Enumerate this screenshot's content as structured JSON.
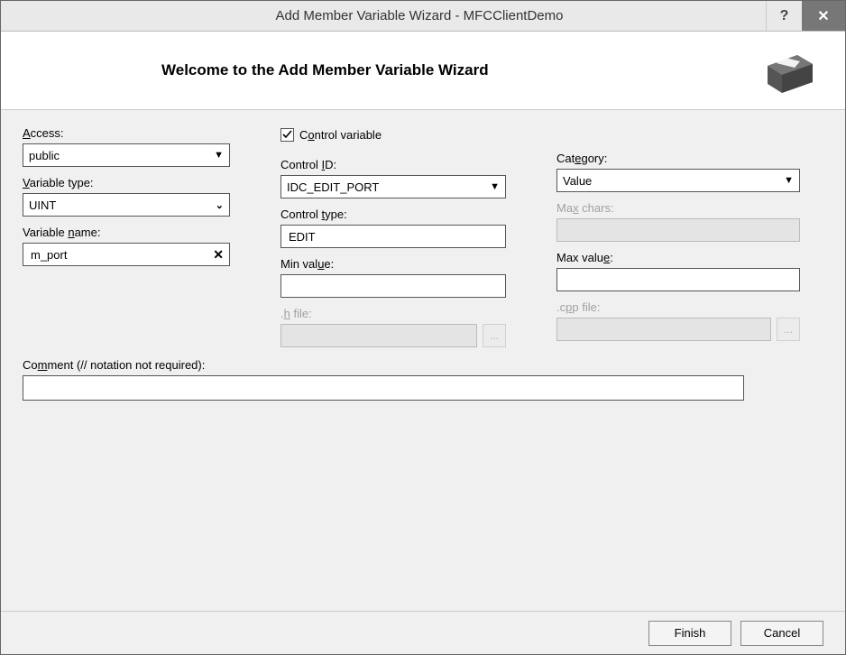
{
  "title": "Add Member Variable Wizard - MFCClientDemo",
  "help_symbol": "?",
  "close_symbol": "✕",
  "banner_heading": "Welcome to the Add Member Variable Wizard",
  "form": {
    "access_label": "Access:",
    "access_value": "public",
    "variable_type_label": "Variable type:",
    "variable_type_value": "UINT",
    "variable_name_label": "Variable name:",
    "variable_name_value": "m_port",
    "control_variable_label": "Control variable",
    "control_variable_checked": true,
    "control_id_label": "Control ID:",
    "control_id_value": "IDC_EDIT_PORT",
    "category_label": "Category:",
    "category_value": "Value",
    "control_type_label": "Control type:",
    "control_type_value": "EDIT",
    "max_chars_label": "Max chars:",
    "max_chars_value": "",
    "min_value_label": "Min value:",
    "min_value_value": "",
    "max_value_label": "Max value:",
    "max_value_value": "",
    "h_file_label": ".h file:",
    "h_file_value": "",
    "cpp_file_label": ".cpp file:",
    "cpp_file_value": "",
    "browse_dots": "...",
    "comment_label": "Comment (// notation not required):",
    "comment_value": ""
  },
  "buttons": {
    "finish": "Finish",
    "cancel": "Cancel"
  }
}
